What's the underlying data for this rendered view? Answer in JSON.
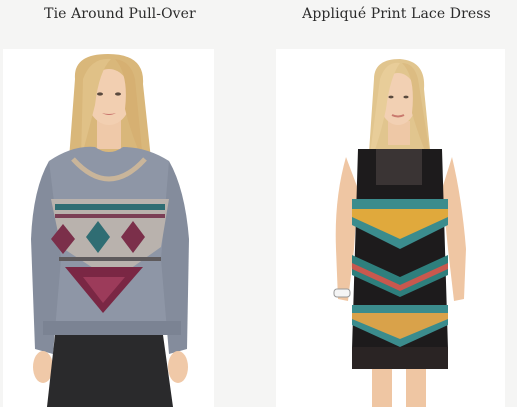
{
  "products": [
    {
      "title": "Tie Around Pull-Over",
      "image_alt": "Model wearing a grey sweater with geometric print"
    },
    {
      "title": "Appliqué Print Lace Dress",
      "image_alt": "Model wearing a black lace dress with colorful geometric print"
    }
  ],
  "colors": {
    "background": "#f5f5f4",
    "photo_bg": "#ffffff",
    "title_text": "#2b2b2b"
  }
}
